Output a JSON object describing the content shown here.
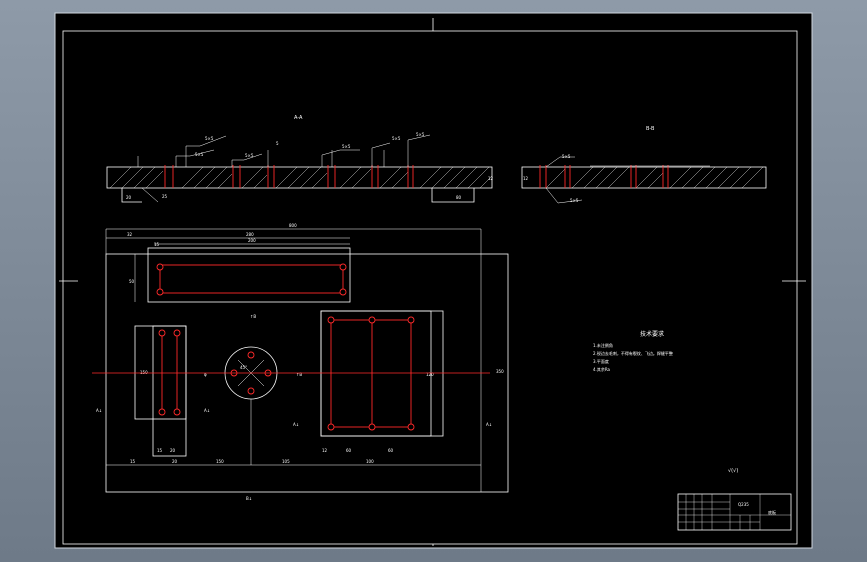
{
  "sheet": {
    "title": "技术要求",
    "notes": [
      "1.未注倒角",
      "2.锐边去毛刺，不得有裂纹、飞边。焊缝平整",
      "3.平面度",
      "4.其余Ra"
    ],
    "roughness_symbol": "√(√)"
  },
  "views": {
    "section_label_left": "A-A",
    "section_label_right": "B-B"
  },
  "dimensions": {
    "overall_width": "800",
    "left_offset": "32",
    "inner_width": "280",
    "plate_width": "200",
    "slot_height": "50",
    "vertical_left": "150",
    "bottom_chain": [
      "15",
      "20",
      "150",
      "105",
      "100"
    ],
    "right_bottom_chain": [
      "12",
      "60",
      "60"
    ],
    "right_height": "120",
    "side_height": "350"
  },
  "title_block": {
    "drawing_name": "底板",
    "material": "Q235"
  },
  "colors": {
    "background": "#000000",
    "frame": "#ffffff",
    "holes": "#ff2a2a"
  }
}
